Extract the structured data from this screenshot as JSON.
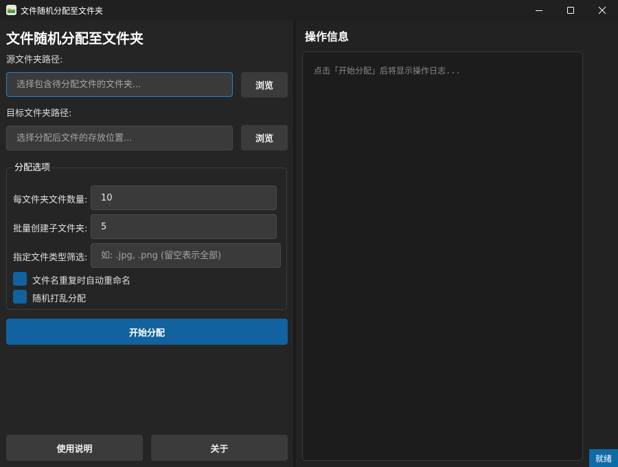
{
  "window": {
    "title": "文件随机分配至文件夹"
  },
  "left": {
    "heading": "文件随机分配至文件夹",
    "source_label": "源文件夹路径:",
    "source_placeholder": "选择包含待分配文件的文件夹...",
    "source_value": "",
    "browse_label": "浏览",
    "target_label": "目标文件夹路径:",
    "target_placeholder": "选择分配后文件的存放位置...",
    "target_value": "",
    "options": {
      "title": "分配选项",
      "per_folder_label": "每文件夹文件数量:",
      "per_folder_value": "10",
      "batch_label": "批量创建子文件夹:",
      "batch_value": "5",
      "filter_label": "指定文件类型筛选:",
      "filter_placeholder": "如: .jpg, .png (留空表示全部)",
      "filter_value": "",
      "rename_label": "文件名重复时自动重命名",
      "shuffle_label": "随机打乱分配"
    },
    "start_label": "开始分配",
    "help_label": "使用说明",
    "about_label": "关于"
  },
  "right": {
    "heading": "操作信息",
    "log_placeholder": "点击「开始分配」后将显示操作日志..."
  },
  "status_bar": {
    "text": "就绪"
  },
  "colors": {
    "accent": "#11629e",
    "background": "#202020",
    "panel": "#252525",
    "input": "#3a3a3a",
    "focus_border": "#2d7fc4"
  }
}
